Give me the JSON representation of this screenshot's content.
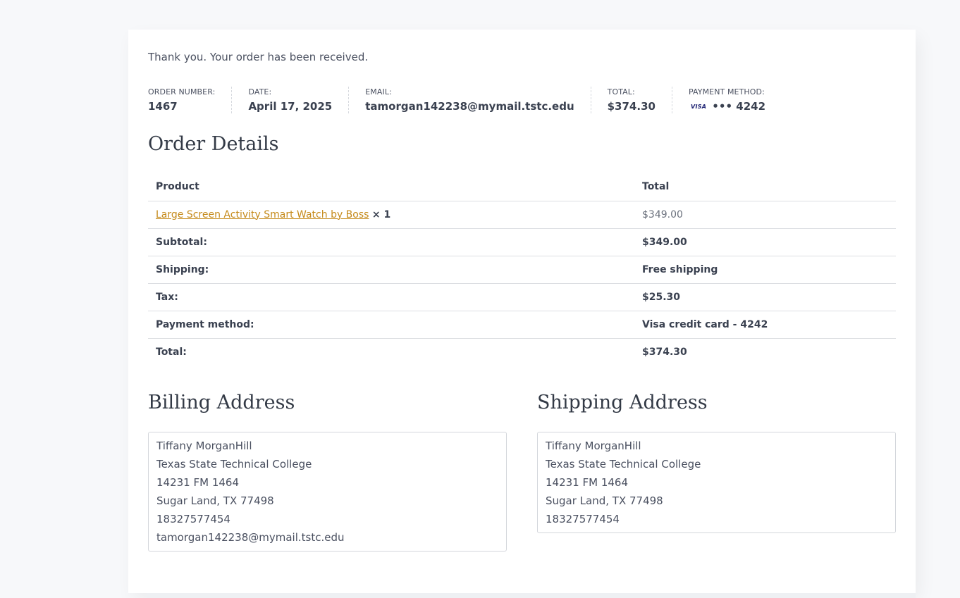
{
  "notice": "Thank you. Your order has been received.",
  "overview": [
    {
      "label": "ORDER NUMBER:",
      "value": "1467"
    },
    {
      "label": "DATE:",
      "value": "April 17, 2025"
    },
    {
      "label": "EMAIL:",
      "value": "tamorgan142238@mymail.tstc.edu"
    },
    {
      "label": "TOTAL:",
      "value": "$374.30"
    },
    {
      "label": "PAYMENT METHOD:",
      "card_brand": "VISA",
      "value": "••• 4242"
    }
  ],
  "order_details": {
    "title": "Order Details",
    "header": {
      "product": "Product",
      "total": "Total"
    },
    "item": {
      "name": "Large Screen Activity Smart Watch by Boss",
      "qty": "× 1",
      "total": "$349.00"
    },
    "rows": [
      {
        "label": "Subtotal:",
        "value": "$349.00"
      },
      {
        "label": "Shipping:",
        "value": "Free shipping"
      },
      {
        "label": "Tax:",
        "value": "$25.30"
      },
      {
        "label": "Payment method:",
        "value": "Visa credit card - 4242"
      },
      {
        "label": "Total:",
        "value": "$374.30"
      }
    ]
  },
  "billing": {
    "title": "Billing Address",
    "lines": [
      "Tiffany MorganHill",
      "Texas State Technical College",
      "14231 FM 1464",
      "Sugar Land, TX 77498",
      "18327577454",
      "tamorgan142238@mymail.tstc.edu"
    ]
  },
  "shipping": {
    "title": "Shipping Address",
    "lines": [
      "Tiffany MorganHill",
      "Texas State Technical College",
      "14231 FM 1464",
      "Sugar Land, TX 77498",
      "18327577454"
    ]
  },
  "colors": {
    "link": "#c58a1a",
    "text": "#3a4150",
    "visa": "#1a1f71"
  }
}
